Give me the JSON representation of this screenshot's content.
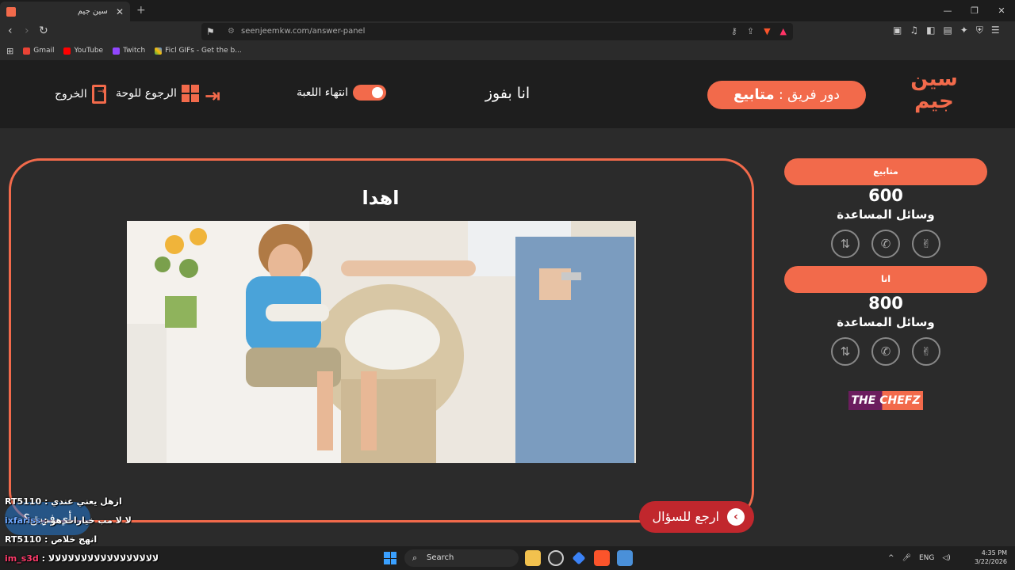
{
  "browser": {
    "tab_title": "سين جيم",
    "tab_close": "✕",
    "new_tab": "+",
    "url": "seenjeemkw.com/answer-panel",
    "bookmarks": [
      {
        "label": "Gmail",
        "color": "#ea4335"
      },
      {
        "label": "YouTube",
        "color": "#ff0000"
      },
      {
        "label": "Twitch",
        "color": "#9146ff"
      },
      {
        "label": "Ficl GIFs - Get the b...",
        "color": "#34a853"
      }
    ]
  },
  "header": {
    "logo_text": "سين جيم",
    "team_turn_prefix": "دور فريق :",
    "team_turn_name": "متابيع",
    "center_title": "انا بفوز",
    "end_game_label": "انتهاء اللعبة",
    "back_to_board_label": "الرجوع للوحة",
    "exit_label": "الخروج"
  },
  "answer": {
    "title": "اهدا",
    "back_button_label": "ارجع للسؤال"
  },
  "teams": [
    {
      "name": "متابيع",
      "score": "600",
      "aids_label": "وسائل المساعدة"
    },
    {
      "name": "انا",
      "score": "800",
      "aids_label": "وسائل المساعدة"
    }
  ],
  "sponsor": "THE CHEFZ",
  "chat": [
    {
      "user": "RT5110",
      "message": "ازهل يعني عندي",
      "user_color": "white"
    },
    {
      "user": "ixfariss",
      "message": "لا لا مب خيارات هو",
      "user_color": "blue"
    },
    {
      "user": "RT5110",
      "message": "انهج خلاص",
      "user_color": "white"
    },
    {
      "user": "im_s3d",
      "message": "ﻻﻻﻻﻻﻻﻻﻻﻻﻻﻻﻻﻻﻻﻻﻻﻻﻻ",
      "user_color": "red"
    }
  ],
  "chat_badge": "أي فريق؟",
  "taskbar": {
    "search_label": "Search",
    "lang": "ENG",
    "time": "4:35 PM",
    "date": "3/22/2026"
  }
}
